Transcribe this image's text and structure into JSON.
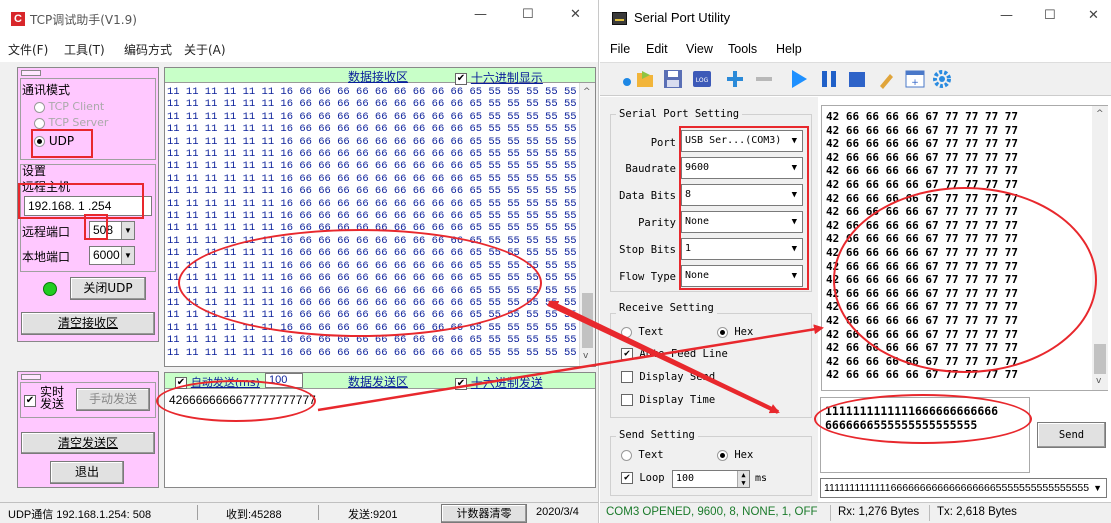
{
  "tcp": {
    "title": "TCP调试助手(V1.9)",
    "menu": [
      "文件(F)",
      "工具(T)",
      "编码方式",
      "关于(A)"
    ],
    "comm_mode_group": "通讯模式",
    "modes": [
      "TCP Client",
      "TCP Server",
      "UDP"
    ],
    "settings_group": "设置",
    "remote_host_label": "远程主机",
    "remote_host_value": "192.168. 1 .254",
    "remote_port_label": "远程端口",
    "remote_port_value": "508",
    "local_port_label": "本地端口",
    "local_port_value": "6000",
    "close_udp_button": "关闭UDP",
    "clear_recv_button": "清空接收区",
    "recv_area_title": "数据接收区",
    "hex_display_label": "十六进制显示",
    "recv_lines": [
      "11 11 11 11 11 11 16 66 66 66 66 66 66 66 66 66 65 55 55 55 55 55 55 55 55  (22)",
      "11 11 11 11 11 11 16 66 66 66 66 66 66 66 66 66 65 55 55 55 55 55 55 55 55  (22)",
      "11 11 11 11 11 11 16 66 66 66 66 66 66 66 66 66 65 55 55 55 55 55 55 55 55  (22)",
      "11 11 11 11 11 11 16 66 66 66 66 66 66 66 66 66 65 55 55 55 55 55 55 55 55  (22)",
      "11 11 11 11 11 11 16 66 66 66 66 66 66 66 66 66 65 55 55 55 55 55 55 55 55  (22)",
      "11 11 11 11 11 11 16 66 66 66 66 66 66 66 66 66 65 55 55 55 55 55 55 55 55  (22)",
      "11 11 11 11 11 11 16 66 66 66 66 66 66 66 66 66 65 55 55 55 55 55 55 55 55  (22)",
      "11 11 11 11 11 11 16 66 66 66 66 66 66 66 66 66 65 55 55 55 55 55 55 55 55  (22)",
      "11 11 11 11 11 11 16 66 66 66 66 66 66 66 66 66 65 55 55 55 55 55 55 55 55  (22)",
      "11 11 11 11 11 11 16 66 66 66 66 66 66 66 66 66 65 55 55 55 55 55 55 55 55  (22)",
      "11 11 11 11 11 11 16 66 66 66 66 66 66 66 66 66 65 55 55 55 55 55 55 55 55  (22)",
      "11 11 11 11 11 11 16 66 66 66 66 66 66 66 66 66 65 55 55 55 55 55 55 55 55  (22)",
      "11 11 11 11 11 11 16 66 66 66 66 66 66 66 66 66 65 55 55 55 55 55 55 55 55  (22)",
      "11 11 11 11 11 11 16 66 66 66 66 66 66 66 66 66 65 55 55 55 55 55 55 55 55  (22)",
      "11 11 11 11 11 11 16 66 66 66 66 66 66 66 66 66 65 55 55 55 55 55 55 55 55  (22)",
      "11 11 11 11 11 11 16 66 66 66 66 66 66 66 66 66 65 55 55 55 55 55 55 55 55  (22)",
      "11 11 11 11 11 11 16 66 66 66 66 66 66 66 66 66 65 55 55 55 55 55 55 55 55  (22)",
      "11 11 11 11 11 11 16 66 66 66 66 66 66 66 66 66 65 55 55 55 55 55 55 55 55  (22)",
      "11 11 11 11 11 11 16 66 66 66 66 66 66 66 66 66 65 55 55 55 55 55 55 55 55  (22)",
      "11 11 11 11 11 11 16 66 66 66 66 66 66 66 66 66 65 55 55 55 55 55 55 55 55  (22)",
      "11 11 11 11 11 11 16 66 66 66 66 66 66 66 66 66 65 55 55 55 55 55 55 55 55  (22)",
      "11 11 11 11 11 11 16 66 66 66 66 66 66 66 66 66 65 55 55 55 55 55 55 55 55  (22)"
    ],
    "realtime_send_label": "实时发送",
    "manual_send_button": "手动发送",
    "auto_send_label": "自动发送(ms)",
    "auto_send_interval": "100",
    "send_area_title": "数据发送区",
    "send_hex_label": "十六进制发送",
    "send_text": "4266666666677777777777",
    "clear_send_button": "清空发送区",
    "exit_button": "退出",
    "status": {
      "udp_info": "UDP通信 192.168.1.254:  508",
      "received": "收到:45288",
      "sent": "发送:9201",
      "clear_counter": "计数器清零",
      "date": "2020/3/4"
    }
  },
  "serial": {
    "title": "Serial Port Utility",
    "menu": [
      "File",
      "Edit",
      "View",
      "Tools",
      "Help"
    ],
    "port_setting_group": "Serial Port Setting",
    "fields": [
      {
        "label": "Port",
        "value": "USB Ser...(COM3)"
      },
      {
        "label": "Baudrate",
        "value": "9600"
      },
      {
        "label": "Data Bits",
        "value": "8"
      },
      {
        "label": "Parity",
        "value": "None"
      },
      {
        "label": "Stop Bits",
        "value": "1"
      },
      {
        "label": "Flow Type",
        "value": "None"
      }
    ],
    "receive_setting_group": "Receive Setting",
    "rx_text_label": "Text",
    "rx_hex_label": "Hex",
    "auto_feed_label": "Auto Feed Line",
    "display_send_label": "Display Send",
    "display_time_label": "Display Time",
    "send_setting_group": "Send Setting",
    "tx_text_label": "Text",
    "tx_hex_label": "Hex",
    "loop_label": "Loop",
    "loop_interval": "100",
    "loop_unit": "ms",
    "rx_lines": [
      "42 66 66 66 66 67 77 77 77 77",
      "42 66 66 66 66 67 77 77 77 77",
      "42 66 66 66 66 67 77 77 77 77",
      "42 66 66 66 66 67 77 77 77 77",
      "42 66 66 66 66 67 77 77 77 77",
      "42 66 66 66 66 67 77 77 77 77",
      "42 66 66 66 66 67 77 77 77 77",
      "42 66 66 66 66 67 77 77 77 77",
      "42 66 66 66 66 67 77 77 77 77",
      "42 66 66 66 66 67 77 77 77 77",
      "42 66 66 66 66 67 77 77 77 77",
      "42 66 66 66 66 67 77 77 77 77",
      "42 66 66 66 66 67 77 77 77 77",
      "42 66 66 66 66 67 77 77 77 77",
      "42 66 66 66 66 67 77 77 77 77",
      "42 66 66 66 66 67 77 77 77 77",
      "42 66 66 66 66 67 77 77 77 77",
      "42 66 66 66 66 67 77 77 77 77",
      "42 66 66 66 66 67 77 77 77 77",
      "42 66 66 66 66 67 77 77 77 77"
    ],
    "send_text_line1": "1111111111111666666666666",
    "send_text_line2": "6666666555555555555555",
    "send_button": "Send",
    "history_value": "11111111111116666666666666666665555555555555555",
    "status": "COM3 OPENED, 9600, 8, NONE, 1, OFF",
    "rx_count": "Rx: 1,276 Bytes",
    "tx_count": "Tx: 2,618 Bytes"
  },
  "icons": [
    "app-icon",
    "open-folder-icon",
    "save-icon",
    "log-icon",
    "add-icon",
    "remove-icon",
    "play-icon",
    "pause-icon",
    "stop-icon",
    "broom-icon",
    "window-icon",
    "gear-icon",
    "minimize-icon",
    "maximize-icon",
    "close-icon"
  ],
  "colors": {
    "annotation_red": "#e8282d",
    "recv_text": "#0a1f9a",
    "panel_pink": "#ffc8ff",
    "header_green": "#c8ffc8",
    "play_blue": "#1e90ff"
  }
}
